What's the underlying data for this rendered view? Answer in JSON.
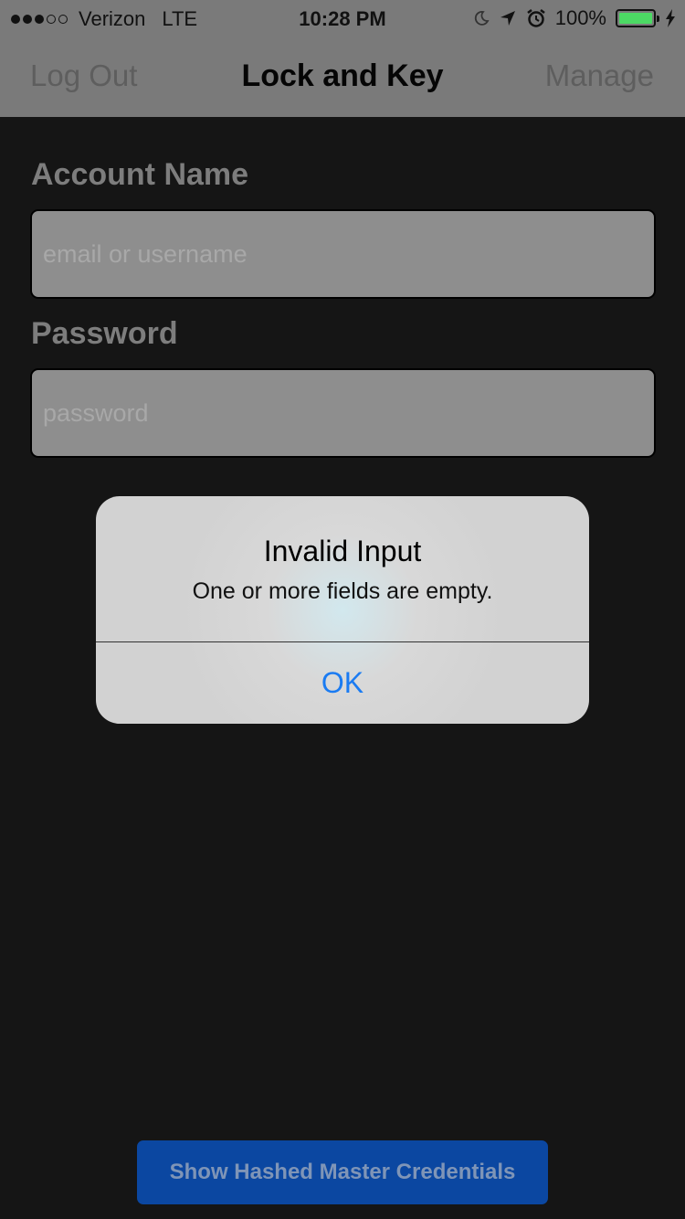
{
  "status_bar": {
    "carrier": "Verizon",
    "network": "LTE",
    "time": "10:28 PM",
    "battery": "100%",
    "battery_level": 1.0,
    "signal_bars_filled": 3,
    "signal_bars_total": 5,
    "icons": [
      "moon-icon",
      "location-arrow-icon",
      "alarm-icon",
      "battery-icon",
      "charging-bolt-icon"
    ]
  },
  "nav": {
    "left": "Log Out",
    "title": "Lock and Key",
    "right": "Manage"
  },
  "form": {
    "account_label": "Account Name",
    "account_placeholder": "email or username",
    "account_value": "",
    "password_label": "Password",
    "password_placeholder": "password",
    "password_value": ""
  },
  "alert": {
    "title": "Invalid Input",
    "message": "One or more fields are empty.",
    "ok": "OK"
  },
  "footer": {
    "button": "Show Hashed Master Credentials"
  },
  "colors": {
    "background": "#151515",
    "bar": "#7a7a7a",
    "accent": "#1a7bf2",
    "button": "#0b47a1",
    "battery": "#4cd964"
  }
}
